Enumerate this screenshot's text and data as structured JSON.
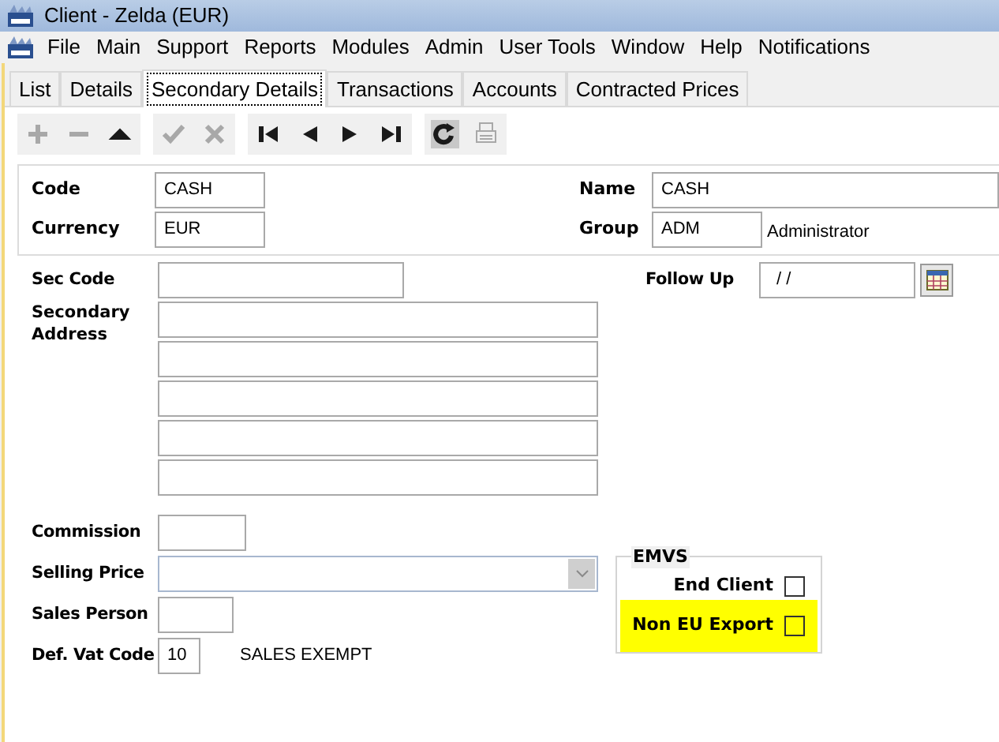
{
  "window": {
    "title": "Client - Zelda (EUR)"
  },
  "menu": [
    "File",
    "Main",
    "Support",
    "Reports",
    "Modules",
    "Admin",
    "User Tools",
    "Window",
    "Help",
    "Notifications"
  ],
  "tabs": [
    {
      "label": "List",
      "selected": false
    },
    {
      "label": "Details",
      "selected": false
    },
    {
      "label": "Secondary Details",
      "selected": true
    },
    {
      "label": "Transactions",
      "selected": false
    },
    {
      "label": "Accounts",
      "selected": false
    },
    {
      "label": "Contracted Prices",
      "selected": false
    }
  ],
  "toolbar": [
    [
      {
        "kind": "add",
        "disabled": true
      },
      {
        "kind": "remove",
        "disabled": true
      },
      {
        "kind": "up",
        "disabled": false
      }
    ],
    [
      {
        "kind": "save",
        "disabled": true
      },
      {
        "kind": "cancel",
        "disabled": true
      }
    ],
    [
      {
        "kind": "first",
        "disabled": false
      },
      {
        "kind": "prev",
        "disabled": false
      },
      {
        "kind": "next",
        "disabled": false
      },
      {
        "kind": "last",
        "disabled": false
      }
    ],
    [
      {
        "kind": "refresh",
        "disabled": false
      },
      {
        "kind": "print",
        "disabled": true
      }
    ]
  ],
  "header": {
    "code": {
      "label": "Code",
      "value": "CASH"
    },
    "currency": {
      "label": "Currency",
      "value": "EUR"
    },
    "name": {
      "label": "Name",
      "value": "CASH"
    },
    "group": {
      "label": "Group",
      "value": "ADM",
      "description": "Administrator"
    }
  },
  "secondary": {
    "sec_code": {
      "label": "Sec Code"
    },
    "address": {
      "label": "Secondary Address"
    },
    "follow_up": {
      "label": "Follow Up",
      "value": "/ /"
    },
    "commission": {
      "label": "Commission"
    },
    "selling_price": {
      "label": "Selling Price"
    },
    "sales_person": {
      "label": "Sales Person"
    },
    "vat_code": {
      "label": "Def. Vat Code",
      "value": "10",
      "description": "SALES EXEMPT"
    }
  },
  "emvs": {
    "title": "EMVS",
    "options": [
      {
        "label": "End Client",
        "checked": false,
        "highlighted": false
      },
      {
        "label": "Non EU Export",
        "checked": false,
        "highlighted": true
      }
    ]
  }
}
